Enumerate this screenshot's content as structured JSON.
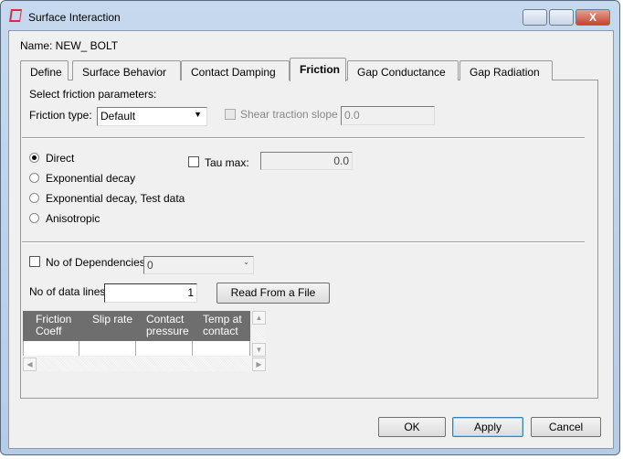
{
  "window": {
    "title": "Surface Interaction",
    "minimize": "_",
    "maximize": "□",
    "close": "X"
  },
  "name_label": "Name: NEW_ BOLT",
  "tabs": [
    {
      "label": "Define"
    },
    {
      "label": "Surface Behavior"
    },
    {
      "label": "Contact Damping"
    },
    {
      "label": "Friction",
      "active": true
    },
    {
      "label": "Gap Conductance"
    },
    {
      "label": "Gap Radiation"
    }
  ],
  "friction": {
    "select_label": "Select friction parameters:",
    "type_label": "Friction type:",
    "type_value": "Default",
    "shear_label": "Shear traction slope",
    "shear_value": "0.0",
    "shear_checked": false,
    "options": [
      {
        "label": "Direct",
        "selected": true
      },
      {
        "label": "Exponential decay"
      },
      {
        "label": "Exponential decay, Test data"
      },
      {
        "label": "Anisotropic"
      }
    ],
    "tau_label": "Tau max:",
    "tau_value": "0.0",
    "tau_checked": false,
    "deps_label": "No of Dependencies",
    "deps_value": "0",
    "deps_checked": false,
    "lines_label": "No of data lines",
    "lines_value": "1",
    "read_button": "Read From a File",
    "table": {
      "columns": [
        "Friction Coeff",
        "Slip rate",
        "Contact pressure",
        "Temp at contact"
      ],
      "rows": [
        [
          "",
          "",
          "",
          ""
        ]
      ]
    }
  },
  "buttons": {
    "ok": "OK",
    "apply": "Apply",
    "cancel": "Cancel"
  }
}
